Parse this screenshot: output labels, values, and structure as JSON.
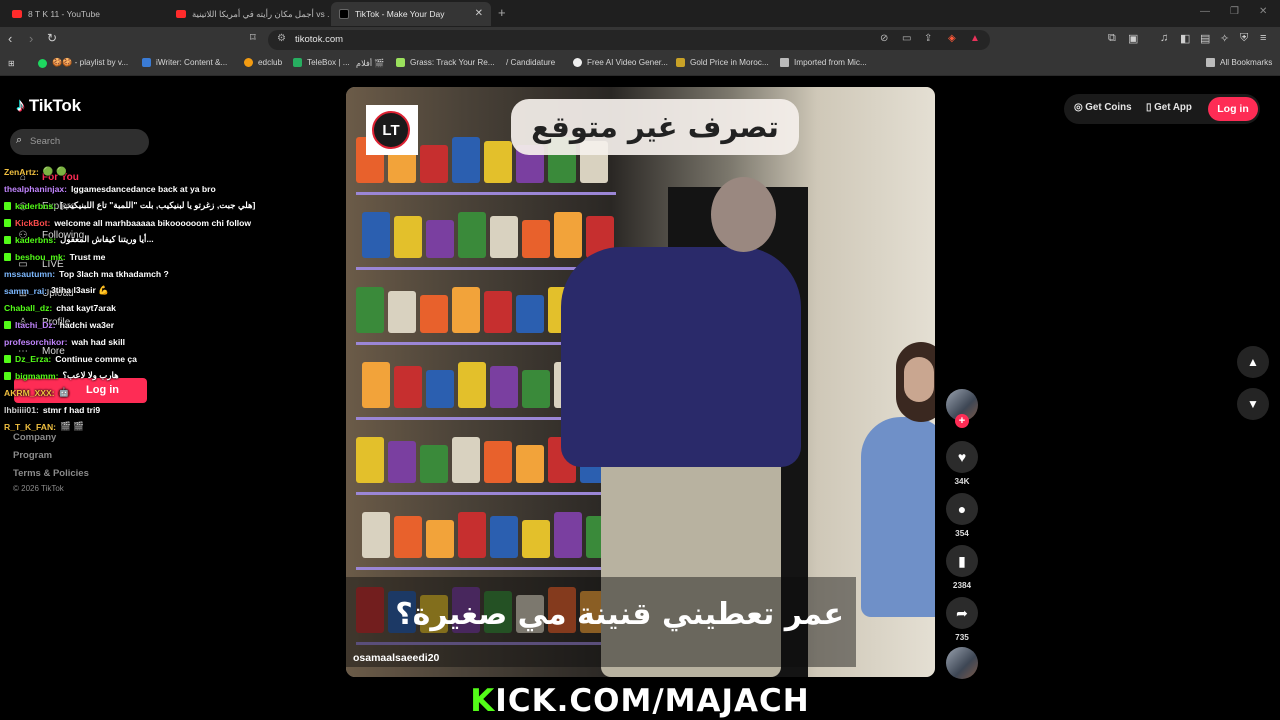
{
  "browser": {
    "tabs": [
      {
        "title": "8 T K 11 - YouTube",
        "active": false
      },
      {
        "title": "أجمل مكان رأيته في أمريكا اللاتينية vs ...",
        "active": false
      },
      {
        "title": "TikTok - Make Your Day",
        "active": true
      }
    ],
    "url": "tikotok.com",
    "bookmarks": [
      "🍪🍪 - playlist by v...",
      "iWriter: Content &...",
      "edclub",
      "TeleBox | ...",
      "أفلام 🎬",
      "Grass: Track Your Re...",
      "/ Candidature",
      "Free AI Video Gener...",
      "Gold Price in Moroc...",
      "Imported from Mic..."
    ],
    "all_bookmarks": "All Bookmarks"
  },
  "tiktok": {
    "logo": "TikTok",
    "search_placeholder": "Search",
    "nav": {
      "for_you": "For You",
      "explore": "Explore",
      "following": "Following",
      "live": "LIVE",
      "upload": "Upload",
      "profile": "Profile",
      "more": "More"
    },
    "login_side": "Log in",
    "footer": [
      "Company",
      "Program",
      "Terms & Policies"
    ],
    "copyright": "© 2026 TikTok",
    "top_right": {
      "get_coins": "Get Coins",
      "get_app": "Get App",
      "login": "Log in"
    },
    "video": {
      "title_overlay": "تصرف غير متوقع",
      "logo": "LT",
      "subtitle": "عمر تعطيني قنينة مي صغيرة؟",
      "author": "osamaalsaeedi20"
    },
    "actions": {
      "likes": "34K",
      "comments": "354",
      "saves": "2384",
      "shares": "735"
    }
  },
  "chat": [
    {
      "user": "ZenArtz:",
      "msg": "🟢 🟢",
      "color": "#f0c040",
      "badge": false
    },
    {
      "user": "thealphaninjax:",
      "msg": "lggamesdancedance back at ya bro",
      "color": "#c084fc",
      "badge": false
    },
    {
      "user": "kaderbns:",
      "msg": "[هلي جبت, زغرتو يا لبنيكيب, بلت \"اللمبة\" تاع اللبنيكيب]",
      "color": "#53fc18",
      "badge": true
    },
    {
      "user": "KickBot:",
      "msg": "welcome all marhbaaaaa bikoooooom chi follow",
      "color": "#ff4d4d",
      "badge": true
    },
    {
      "user": "kaderbns:",
      "msg": "أيا وريتنا كيفاش المعقول...",
      "color": "#53fc18",
      "badge": true
    },
    {
      "user": "beshou_mk:",
      "msg": "Trust me",
      "color": "#53fc18",
      "badge": true
    },
    {
      "user": "mssautumn:",
      "msg": "Top 3lach ma tkhadamch ?",
      "color": "#7db9ff",
      "badge": false
    },
    {
      "user": "samm_rai:",
      "msg": "3tiha l3asir 💪",
      "color": "#7db9ff",
      "badge": false
    },
    {
      "user": "Chaball_dz:",
      "msg": "chat kayt7arak",
      "color": "#53fc18",
      "badge": false
    },
    {
      "user": "Itachi_Dz:",
      "msg": "hadchi wa3er",
      "color": "#c084fc",
      "badge": true
    },
    {
      "user": "profesorchikor:",
      "msg": "wah had skill",
      "color": "#c084fc",
      "badge": false
    },
    {
      "user": "Dz_Erza:",
      "msg": "Continue comme ça",
      "color": "#53fc18",
      "badge": true
    },
    {
      "user": "bigmamm:",
      "msg": "هارب ولا لاعب؟",
      "color": "#53fc18",
      "badge": true
    },
    {
      "user": "AKRM_XXX:",
      "msg": "🤖",
      "color": "#f0c040",
      "badge": false
    },
    {
      "user": "lhbiiii01:",
      "msg": "stmr f had tri9",
      "color": "#cfcfcf",
      "badge": false
    },
    {
      "user": "R_T_K_FAN:",
      "msg": "🎬 🎬",
      "color": "#f0c040",
      "badge": false
    }
  ],
  "stream_banner": {
    "k": "K",
    "rest": "ICK.COM/MAJACH"
  },
  "colors": {
    "tiktok_red": "#fe2c55",
    "kick_green": "#53fc18"
  }
}
